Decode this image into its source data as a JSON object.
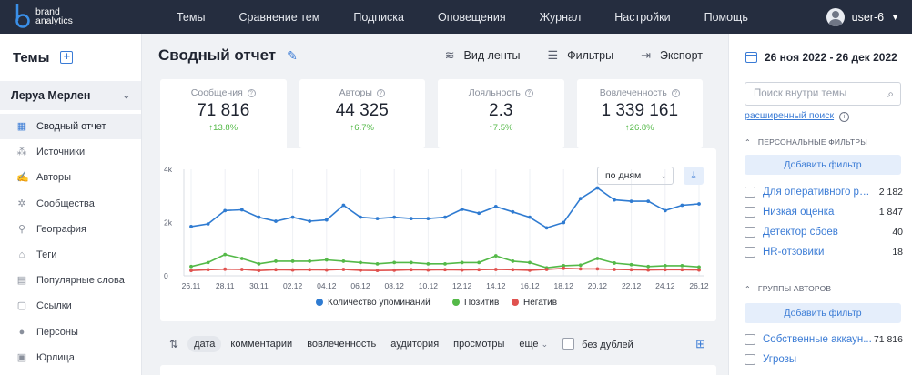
{
  "brand": {
    "line1": "brand",
    "line2": "analytics"
  },
  "nav": {
    "items": [
      "Темы",
      "Сравнение тем",
      "Подписка",
      "Оповещения",
      "Журнал",
      "Настройки",
      "Помощь"
    ]
  },
  "user": {
    "name": "user-6"
  },
  "sidebar": {
    "title": "Темы",
    "project": "Леруа Мерлен",
    "items": [
      {
        "label": "Сводный отчет",
        "icon": "grid-icon"
      },
      {
        "label": "Источники",
        "icon": "sources-icon"
      },
      {
        "label": "Авторы",
        "icon": "authors-icon"
      },
      {
        "label": "Сообщества",
        "icon": "communities-icon"
      },
      {
        "label": "География",
        "icon": "map-pin-icon"
      },
      {
        "label": "Теги",
        "icon": "tag-icon"
      },
      {
        "label": "Популярные слова",
        "icon": "words-icon"
      },
      {
        "label": "Ссылки",
        "icon": "link-icon"
      },
      {
        "label": "Персоны",
        "icon": "person-icon"
      },
      {
        "label": "Юрлица",
        "icon": "company-icon"
      }
    ]
  },
  "main": {
    "title": "Сводный отчет",
    "actions": {
      "feed": "Вид ленты",
      "filters": "Фильтры",
      "export": "Экспорт"
    },
    "kpis": [
      {
        "label": "Сообщения",
        "value": "71 816",
        "delta": "↑13.8%"
      },
      {
        "label": "Авторы",
        "value": "44 325",
        "delta": "↑6.7%"
      },
      {
        "label": "Лояльность",
        "value": "2.3",
        "delta": "↑7.5%"
      },
      {
        "label": "Вовлеченность",
        "value": "1 339 161",
        "delta": "↑26.8%"
      }
    ],
    "period_select": "по дням",
    "tabs": [
      "дата",
      "комментарии",
      "вовлеченность",
      "аудитория",
      "просмотры",
      "еще"
    ],
    "no_duplicates": "без дублей"
  },
  "chart_data": {
    "type": "line",
    "title": "",
    "xlabel": "",
    "ylabel": "",
    "ylim": [
      0,
      4000
    ],
    "y_ticks": [
      "0",
      "2k",
      "4k"
    ],
    "x_tick_labels": [
      "26.11",
      "28.11",
      "30.11",
      "02.12",
      "04.12",
      "06.12",
      "08.12",
      "10.12",
      "12.12",
      "14.12",
      "16.12",
      "18.12",
      "20.12",
      "22.12",
      "24.12",
      "26.12"
    ],
    "x": [
      "26.11",
      "27.11",
      "28.11",
      "29.11",
      "30.11",
      "01.12",
      "02.12",
      "03.12",
      "04.12",
      "05.12",
      "06.12",
      "07.12",
      "08.12",
      "09.12",
      "10.12",
      "11.12",
      "12.12",
      "13.12",
      "14.12",
      "15.12",
      "16.12",
      "17.12",
      "18.12",
      "19.12",
      "20.12",
      "21.12",
      "22.12",
      "23.12",
      "24.12",
      "25.12",
      "26.12"
    ],
    "series": [
      {
        "name": "Количество упоминаний",
        "color": "#2f7bd1",
        "values": [
          1850,
          1950,
          2450,
          2480,
          2200,
          2050,
          2200,
          2050,
          2100,
          2650,
          2200,
          2150,
          2200,
          2150,
          2150,
          2200,
          2500,
          2350,
          2600,
          2400,
          2200,
          1800,
          2000,
          2900,
          3300,
          2850,
          2800,
          2800,
          2450,
          2650,
          2700
        ]
      },
      {
        "name": "Позитив",
        "color": "#54b948",
        "values": [
          350,
          500,
          800,
          650,
          450,
          550,
          550,
          550,
          600,
          550,
          500,
          450,
          500,
          500,
          450,
          450,
          500,
          500,
          750,
          550,
          500,
          300,
          380,
          400,
          650,
          480,
          420,
          350,
          380,
          380,
          330
        ]
      },
      {
        "name": "Негатив",
        "color": "#e0524f",
        "values": [
          200,
          230,
          250,
          240,
          200,
          230,
          220,
          230,
          220,
          240,
          210,
          200,
          210,
          230,
          220,
          230,
          220,
          230,
          240,
          230,
          210,
          240,
          280,
          260,
          260,
          240,
          230,
          220,
          230,
          230,
          220
        ]
      }
    ],
    "legend_position": "bottom"
  },
  "right_panel": {
    "date_range": "26 ноя 2022 - 26 дек 2022",
    "search_placeholder": "Поиск внутри темы",
    "advanced_search": "расширенный поиск",
    "personal_filters_title": "ПЕРСОНАЛЬНЫЕ ФИЛЬТРЫ",
    "add_filter": "Добавить фильтр",
    "personal_filters": [
      {
        "name": "Для оперативного ре...",
        "count": "2 182"
      },
      {
        "name": "Низкая оценка",
        "count": "1 847"
      },
      {
        "name": "Детектор сбоев",
        "count": "40"
      },
      {
        "name": "HR-отзовики",
        "count": "18"
      }
    ],
    "author_groups_title": "ГРУППЫ АВТОРОВ",
    "author_groups": [
      {
        "name": "Собственные аккаун...",
        "count": "71 816"
      },
      {
        "name": "Угрозы",
        "count": ""
      }
    ]
  }
}
